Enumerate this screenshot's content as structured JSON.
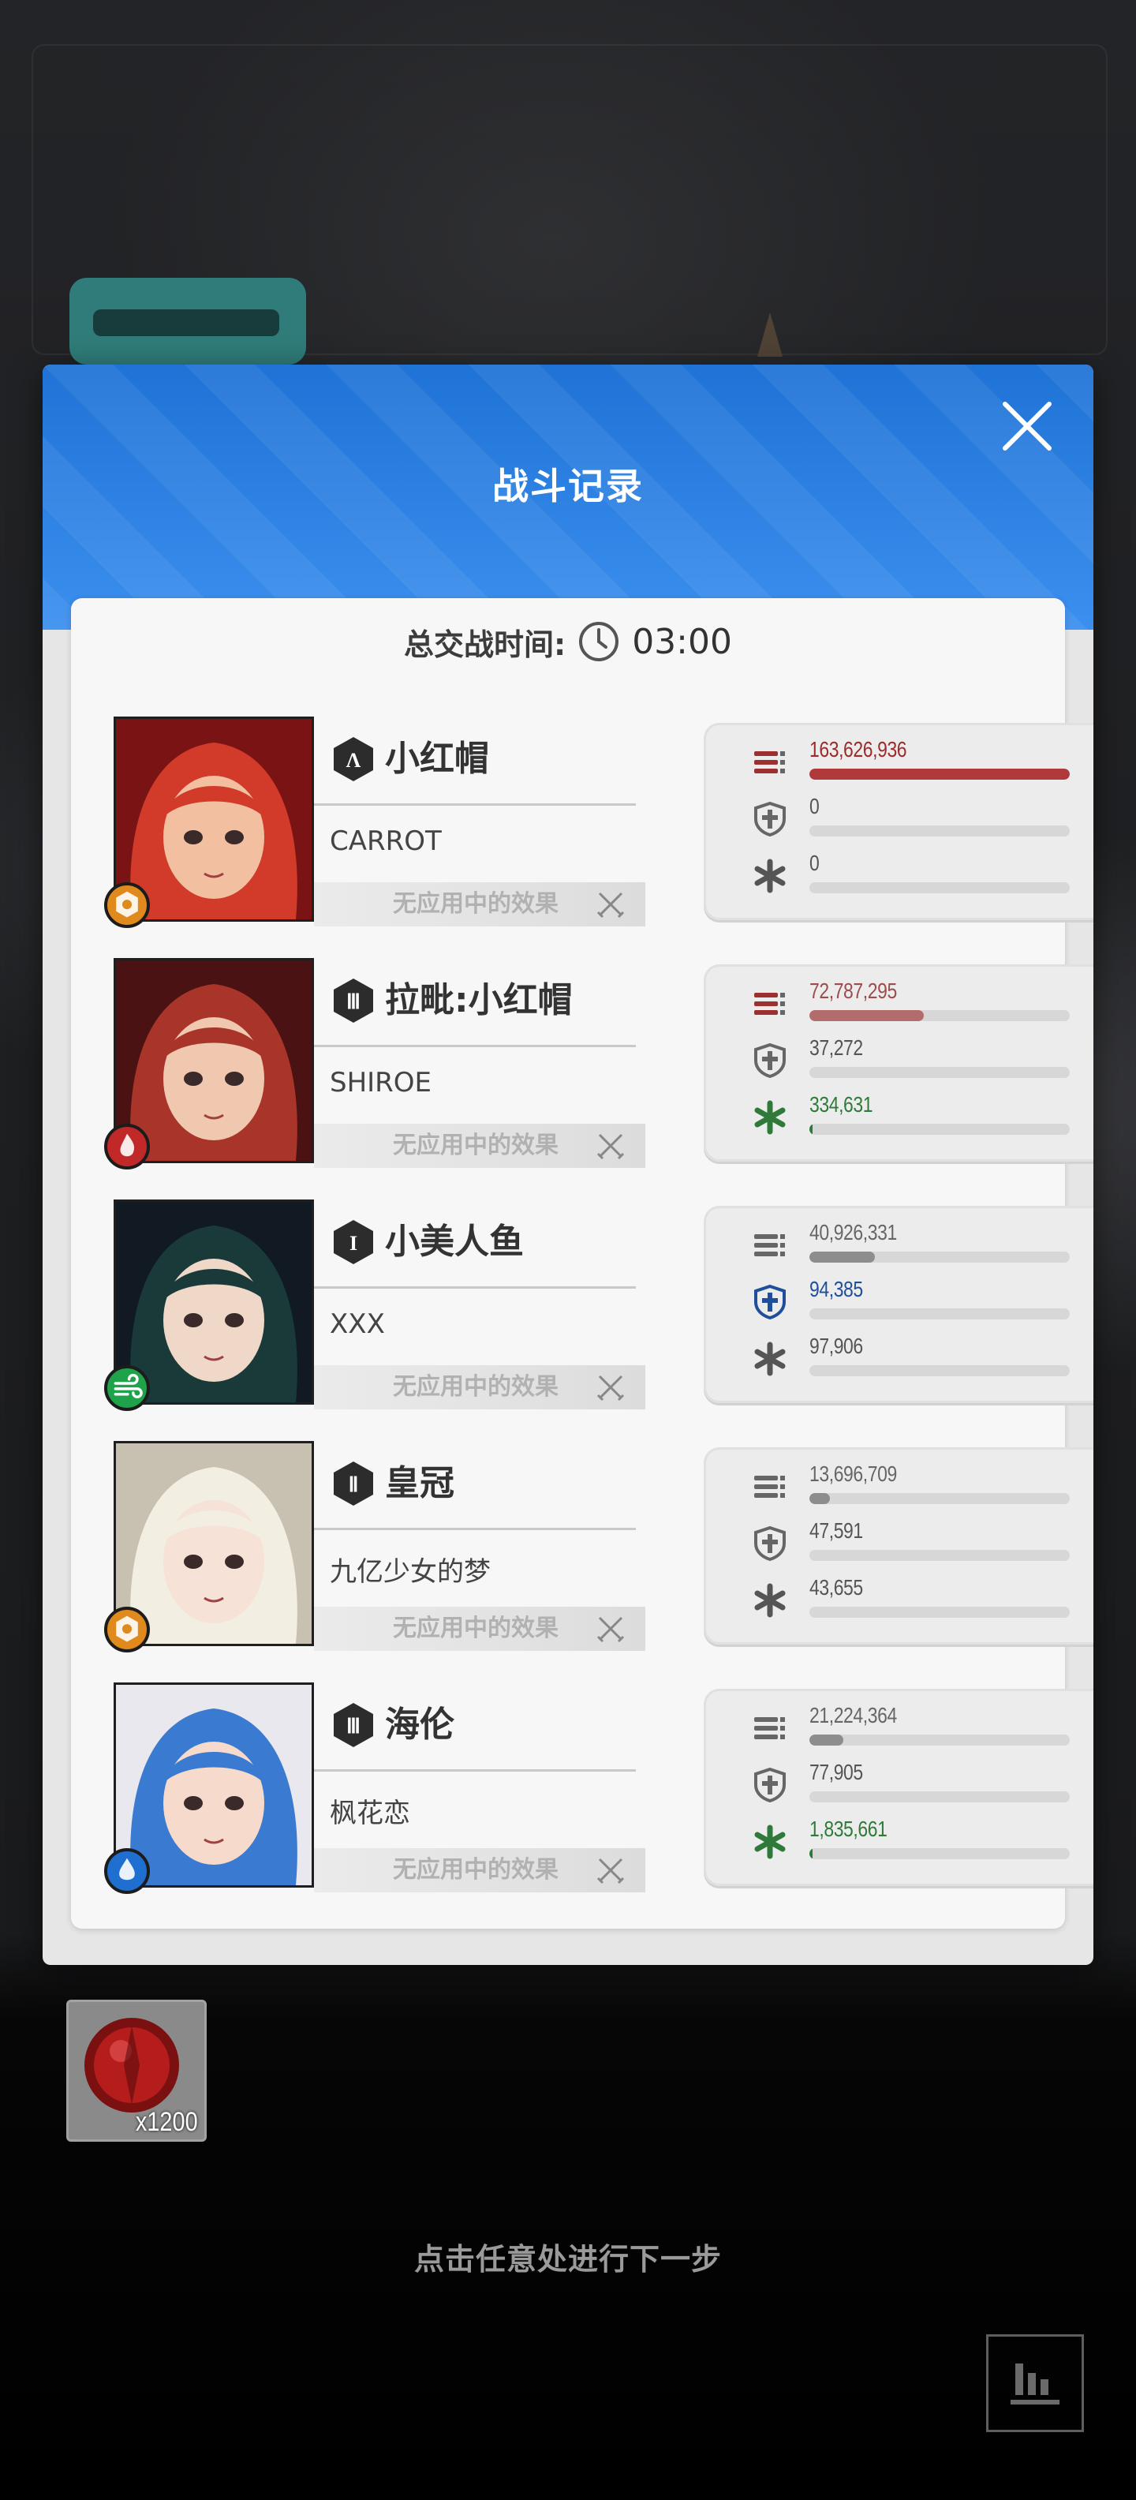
{
  "modal": {
    "title": "战斗记录",
    "battle_time_label": "总交战时间:",
    "battle_time_value": "03:00"
  },
  "records": [
    {
      "burst": "Λ",
      "character": "小红帽",
      "player": "CARROT",
      "effect": "无应用中的效果",
      "element": "iron",
      "element_color": "#e08a1e",
      "damage": "163,626,936",
      "damage_ratio": 1.0,
      "damage_color": "#b03a3a",
      "damage_text_color": "#9c2b2b",
      "shield": "0",
      "shield_ratio": 0.0,
      "heal": "0",
      "heal_ratio": 0.0
    },
    {
      "burst": "Ⅲ",
      "character": "拉毗:小红帽",
      "player": "SHIROE",
      "effect": "无应用中的效果",
      "element": "fire",
      "element_color": "#c12828",
      "damage": "72,787,295",
      "damage_ratio": 0.44,
      "damage_color": "#b36c6c",
      "damage_text_color": "#9c4c4c",
      "shield": "37,272",
      "shield_ratio": 0.0,
      "heal": "334,631",
      "heal_ratio": 0.01,
      "heal_text_color": "#2f7a3a"
    },
    {
      "burst": "I",
      "character": "小美人鱼",
      "player": "XXX",
      "effect": "无应用中的效果",
      "element": "wind",
      "element_color": "#1fa34a",
      "damage": "40,926,331",
      "damage_ratio": 0.25,
      "damage_color": "#8d8d8d",
      "damage_text_color": "#666",
      "shield": "94,385",
      "shield_ratio": 0.0,
      "shield_text_color": "#1f4f9a",
      "heal": "97,906",
      "heal_ratio": 0.0
    },
    {
      "burst": "Ⅱ",
      "character": "皇冠",
      "player": "九亿少女的梦",
      "effect": "无应用中的效果",
      "element": "iron",
      "element_color": "#e08a1e",
      "damage": "13,696,709",
      "damage_ratio": 0.08,
      "damage_color": "#8d8d8d",
      "damage_text_color": "#666",
      "shield": "47,591",
      "shield_ratio": 0.0,
      "heal": "43,655",
      "heal_ratio": 0.0
    },
    {
      "burst": "Ⅲ",
      "character": "海伦",
      "player": "枫花恋",
      "effect": "无应用中的效果",
      "element": "water",
      "element_color": "#1f6fd0",
      "damage": "21,224,364",
      "damage_ratio": 0.13,
      "damage_color": "#8d8d8d",
      "damage_text_color": "#666",
      "shield": "77,905",
      "shield_ratio": 0.0,
      "heal": "1,835,661",
      "heal_ratio": 0.01,
      "heal_text_color": "#2f7a3a"
    }
  ],
  "reward": {
    "count": "x1200"
  },
  "footer": {
    "hint": "点击任意处进行下一步"
  },
  "icons": {
    "close": "close-icon",
    "clock": "clock-icon",
    "damage": "bullets-icon",
    "shield": "shield-icon",
    "heal": "heal-cross-icon",
    "effect": "crossed-swords-icon",
    "stats": "bar-chart-icon"
  }
}
